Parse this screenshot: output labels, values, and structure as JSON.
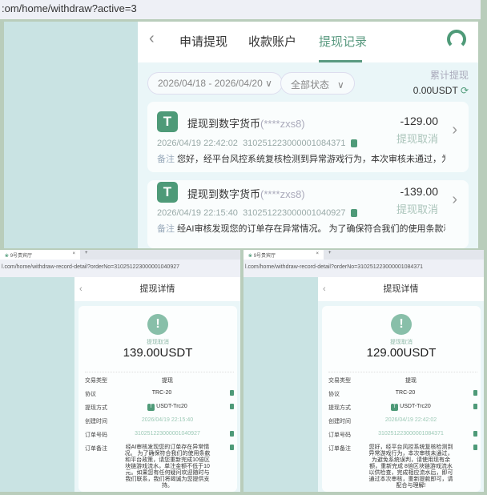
{
  "main": {
    "url": ":om/home/withdraw?active=3",
    "tabs": [
      {
        "label": "申请提现"
      },
      {
        "label": "收款账户"
      },
      {
        "label": "提现记录",
        "active": true
      }
    ],
    "date_range": "2026/04/18 - 2026/04/20",
    "status_filter": "全部状态",
    "total_label": "累计提现",
    "total_value": "0.00USDT",
    "records": [
      {
        "title": "提现到数字货币",
        "account": "(****zxs8)",
        "time": "2026/04/19 22:42:02",
        "order_no": "310251223000001084371",
        "note_label": "备注",
        "note": "您好，经平台风控系统复核检测到异常游戏行为，本次审核未通过，为...",
        "amount": "-129.00",
        "status": "提现取消"
      },
      {
        "title": "提现到数字货币",
        "account": "(****zxs8)",
        "time": "2026/04/19 22:15:40",
        "order_no": "310251223000001040927",
        "note_label": "备注",
        "note": "经AI审核发现您的订单存在异常情况。 为了确保符合我们的使用条款和...",
        "amount": "-139.00",
        "status": "提现取消"
      }
    ]
  },
  "details": [
    {
      "tab_title": "9号贵宾厅",
      "url": "l.com/home/withdraw-record-detail?orderNo=310251223000001040927",
      "title": "提现详情",
      "status": "提现取消",
      "amount": "139.00USDT",
      "rows": [
        {
          "k": "交易类型",
          "v": "提现"
        },
        {
          "k": "协议",
          "v": "TRC-20"
        },
        {
          "k": "提现方式",
          "v": "USDT-Trc20"
        },
        {
          "k": "创建时间",
          "v": "2026/04/19 22:15:40"
        },
        {
          "k": "订单号码",
          "v": "310251223000001040927"
        },
        {
          "k": "订单备注",
          "v": "经AI审核发现您的订单存在异常情况。 为了确保符合我们的使用条款和平台政策，请您重新完成10倍区块链游戏流水，单注金额不低于10元。如果您有任何疑问欢迎随时与我们联系，我们将竭诚为您提供支持。"
        }
      ]
    },
    {
      "tab_title": "9号贵宾厅",
      "url": "l.com/home/withdraw-record-detail?orderNo=310251223000001084371",
      "title": "提现详情",
      "status": "提现取消",
      "amount": "129.00USDT",
      "rows": [
        {
          "k": "交易类型",
          "v": "提现"
        },
        {
          "k": "协议",
          "v": "TRC-20"
        },
        {
          "k": "提现方式",
          "v": "USDT-Trc20"
        },
        {
          "k": "创建时间",
          "v": "2026/04/19 22:42:02"
        },
        {
          "k": "订单号码",
          "v": "310251223000001084371"
        },
        {
          "k": "订单备注",
          "v": "您好，经平台风控系统复核检测到异常游戏行为，本次审核未通过，为避免系统误判，请使用现有余额，重新完成 8倍区块链游戏流水以供检查，完成相应流水后，即可通过本次审核，重新提款即可，请配合与理解!"
        }
      ]
    }
  ],
  "colors": {
    "accent": "#5a9a80",
    "icon": "#4e9a78",
    "panel": "#c9e3e3"
  }
}
